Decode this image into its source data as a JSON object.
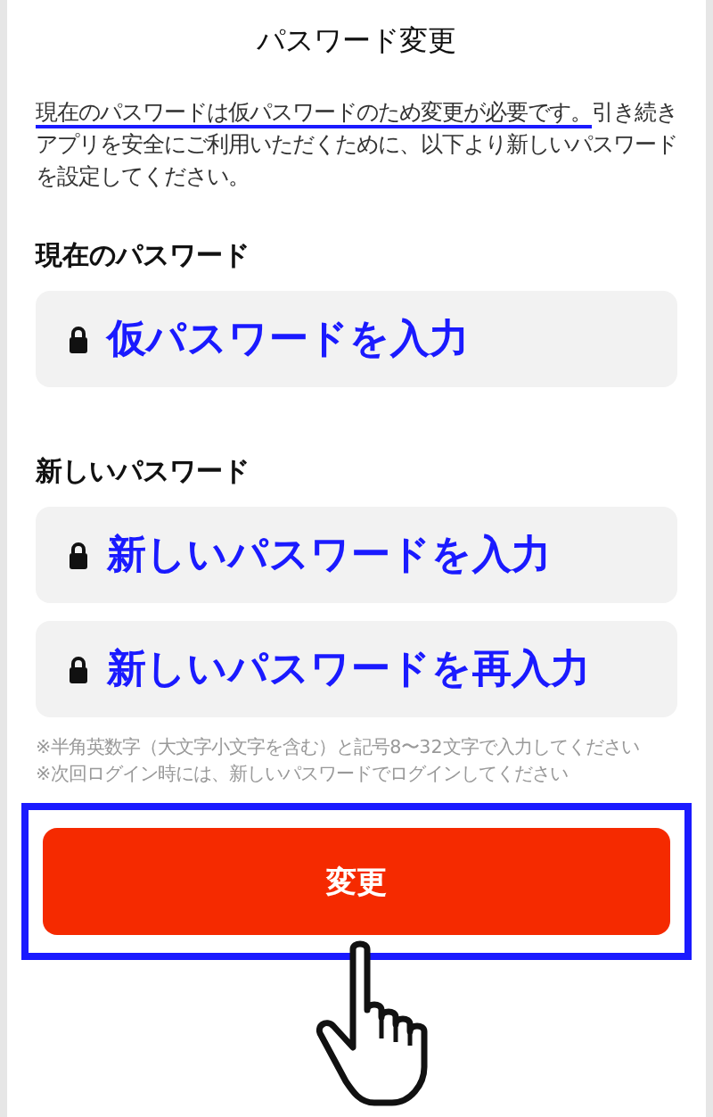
{
  "title": "パスワード変更",
  "description": {
    "highlighted": "現在のパスワードは仮パスワードのため変更が必要です。",
    "text": "引き続きアプリを安全にご利用いただくために、以下より新しいパスワードを設定してください。"
  },
  "sections": [
    {
      "label": "現在のパスワード",
      "fields": [
        {
          "placeholder": "仮パスワードを入力"
        }
      ]
    },
    {
      "label": "新しいパスワード",
      "fields": [
        {
          "placeholder": "新しいパスワードを入力"
        },
        {
          "placeholder": "新しいパスワードを再入力"
        }
      ]
    }
  ],
  "notes": [
    "※半角英数字（大文字小文字を含む）と記号8〜32文字で入力してください",
    "※次回ログイン時には、新しいパスワードでログインしてください"
  ],
  "submit_button": {
    "label": "変更",
    "highlighted": true
  }
}
